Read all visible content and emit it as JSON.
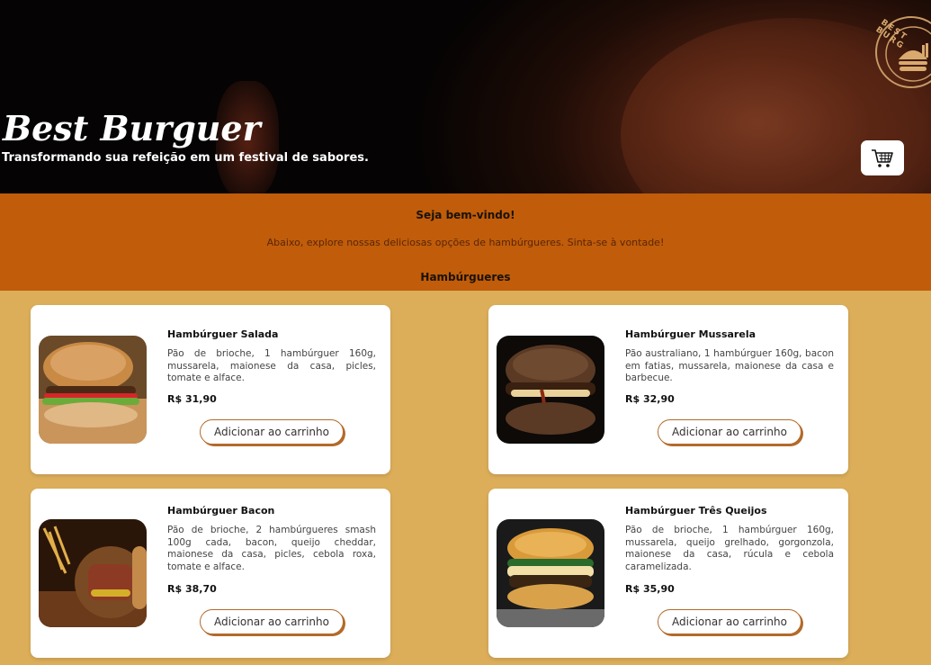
{
  "header": {
    "title": "Best Burguer",
    "subtitle": "Transformando sua refeição em um festival de sabores.",
    "logo_text": "BEST BURG"
  },
  "welcome": {
    "title": "Seja bem-vindo!",
    "text": "Abaixo, explore nossas deliciosas opções de hambúrgueres. Sinta-se à vontade!",
    "section_title": "Hambúrgueres"
  },
  "products": [
    {
      "name": "Hambúrguer Salada",
      "description": "Pão de brioche, 1 hambúrguer 160g, mussarela, maionese da casa, picles, tomate e alface.",
      "price": "R$ 31,90",
      "button_label": "Adicionar ao carrinho"
    },
    {
      "name": "Hambúrguer Mussarela",
      "description": "Pão australiano, 1 hambúrguer 160g, bacon em fatias, mussarela, maionese da casa e barbecue.",
      "price": "R$ 32,90",
      "button_label": "Adicionar ao carrinho"
    },
    {
      "name": "Hambúrguer Bacon",
      "description": "Pão de brioche, 2 hambúrgueres smash 100g cada, bacon, queijo cheddar, maionese da casa, picles, cebola roxa, tomate e alface.",
      "price": "R$ 38,70",
      "button_label": "Adicionar ao carrinho"
    },
    {
      "name": "Hambúrguer Três Queijos",
      "description": "Pão de brioche, 1 hambúrguer 160g, mussarela, queijo grelhado, gorgonzola, maionese da casa, rúcula e cebola caramelizada.",
      "price": "R$ 35,90",
      "button_label": "Adicionar ao carrinho"
    }
  ],
  "icons": {
    "cart": "cart-icon",
    "logo": "burger-logo-icon"
  },
  "colors": {
    "page_background": "#dcae5a",
    "welcome_band": "#c05c0a",
    "button_border": "#b36a2a"
  }
}
